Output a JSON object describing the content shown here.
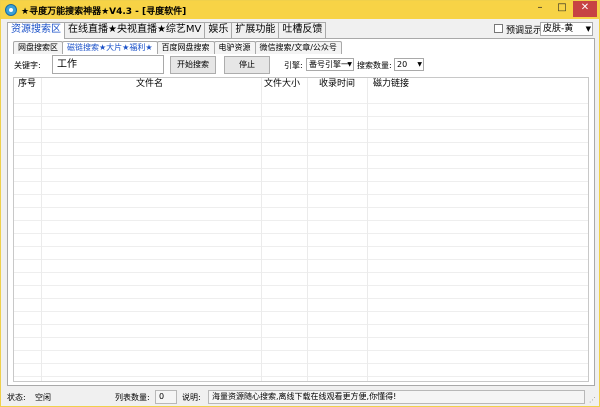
{
  "window": {
    "title": "★寻度万能搜索神器★V4.3 - [寻度软件]",
    "min_glyph": "–",
    "max_glyph": "□",
    "close_glyph": "✕"
  },
  "main_tabs": [
    {
      "label": "资源搜索区",
      "active": true
    },
    {
      "label": "在线直播★央视直播★综艺MV",
      "active": false
    },
    {
      "label": "娱乐",
      "active": false
    },
    {
      "label": "扩展功能",
      "active": false
    },
    {
      "label": "吐槽反馈",
      "active": false
    }
  ],
  "top_right": {
    "checkbox_label": "预调显示",
    "checkbox_checked": false,
    "skin_value": "皮肤-黄"
  },
  "sub_tabs": [
    {
      "label": "网盘搜索区",
      "active": false
    },
    {
      "label": "磁链搜索★大片★福利★",
      "active": true
    },
    {
      "label": "百度网盘搜索",
      "active": false
    },
    {
      "label": "电驴资源",
      "active": false
    },
    {
      "label": "微信搜索/文章/公众号",
      "active": false
    }
  ],
  "search": {
    "keyword_label": "关键字:",
    "keyword_value": "工作",
    "start_button": "开始搜索",
    "stop_button": "停止",
    "engine_label": "引擎:",
    "engine_value": "番号引擎一",
    "count_label": "搜索数量:",
    "count_value": "20"
  },
  "list": {
    "columns": [
      "序号",
      "文件名",
      "文件大小",
      "收录时间",
      "磁力链接"
    ],
    "rows": []
  },
  "status": {
    "state_label": "状态:",
    "state_value": "空闲",
    "count_label": "列表数量:",
    "count_value": "0",
    "desc_label": "说明:",
    "desc_value": "海量资源随心搜索,离线下载在线观看更方便,你懂得!"
  },
  "colors": {
    "titlebar": "#f7d346",
    "active_tab_text": "#1a50c8",
    "close_button": "#c74343"
  }
}
